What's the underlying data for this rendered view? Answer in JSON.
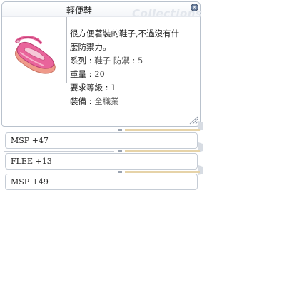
{
  "item": {
    "name": "輕便鞋",
    "watermark": "Collections",
    "description": [
      "很方便著裝的鞋子,不過沒有什",
      "麼防禦力。"
    ],
    "stats": [
      {
        "label": "系列 : ",
        "value": "鞋子  防禦 : 5"
      },
      {
        "label": "重量 : ",
        "value": "20"
      },
      {
        "label": "要求等級 : ",
        "value": "1"
      },
      {
        "label": "裝備 : ",
        "value": "全職業"
      }
    ],
    "image_icon": "pink-shoe-icon"
  },
  "options": [
    {
      "text": "MSP +47"
    },
    {
      "text": "FLEE +13"
    },
    {
      "text": "MSP +49"
    }
  ],
  "colors": {
    "border": "#b9c2cd",
    "shoe_pink": "#e9649b",
    "shoe_sole": "#ef9a8a"
  }
}
